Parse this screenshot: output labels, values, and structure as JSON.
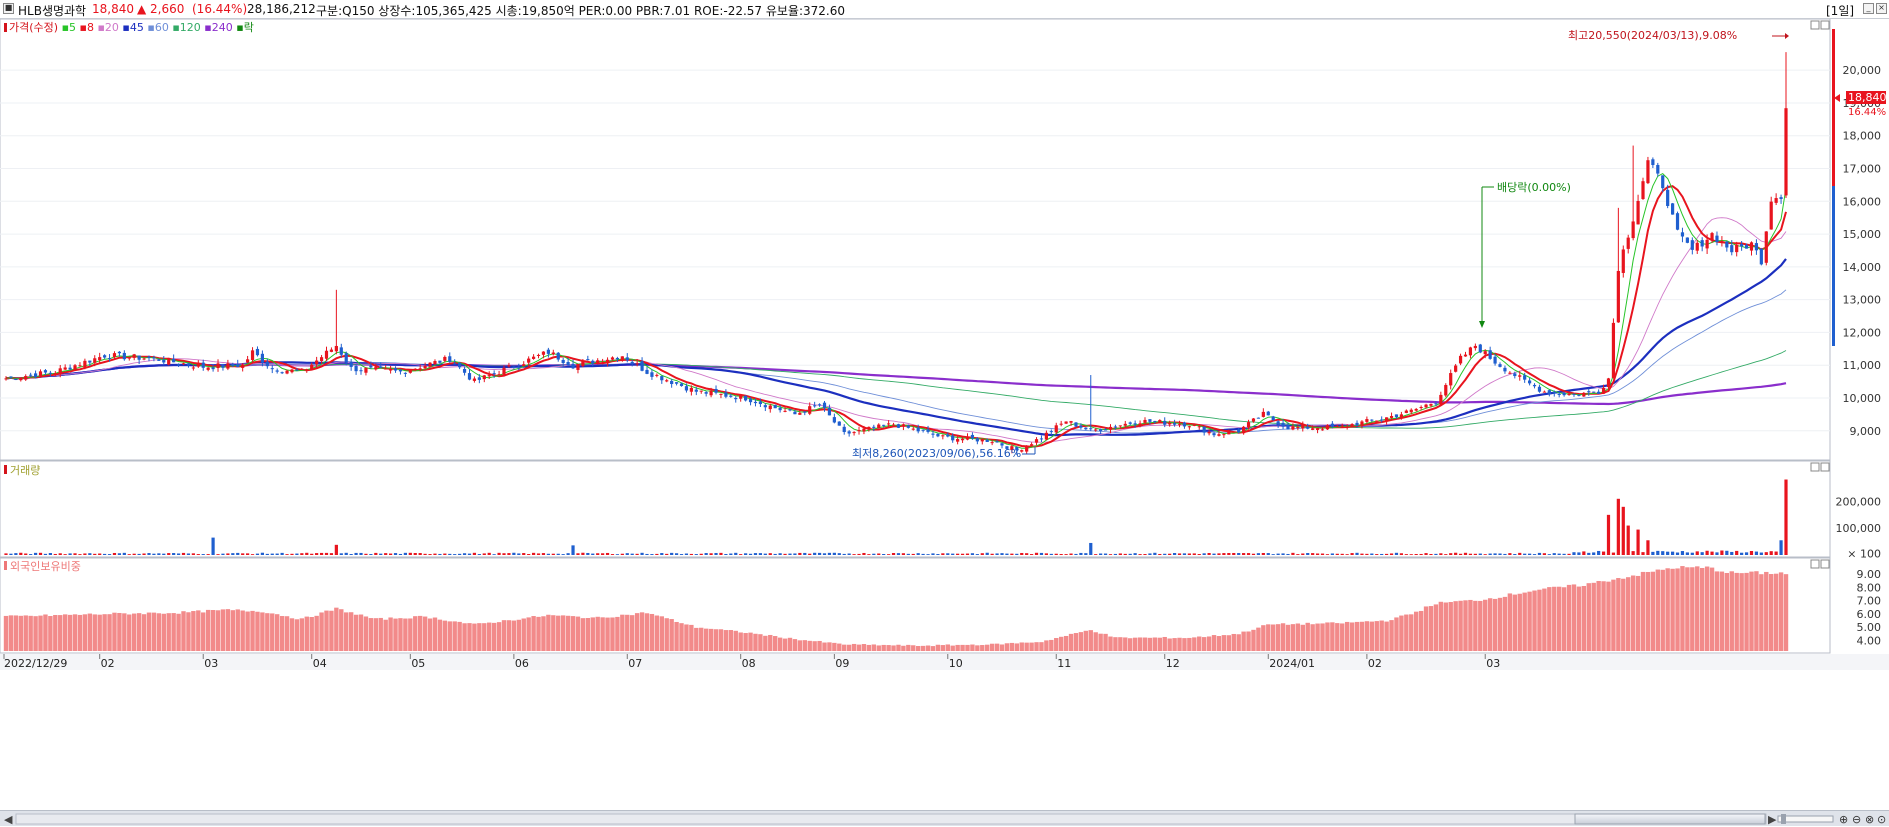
{
  "header": {
    "stock_name": "HLB생명과학",
    "price": "18,840",
    "change": "▲ 2,660",
    "change_pct": "(16.44%)",
    "volume": "28,186,212",
    "info": "구분:Q150 상장수:105,365,425 시총:19,850억 PER:0.00 PBR:7.01 ROE:-22.57 유보율:372.60",
    "period": "[1일]",
    "colors": {
      "up": "#e8141e",
      "down": "#1f5fcf"
    }
  },
  "price_panel": {
    "legend": [
      {
        "text": "가격(수정)",
        "color": "#d4131b"
      },
      {
        "text": "5",
        "color": "#27c427"
      },
      {
        "text": "8",
        "color": "#e8141e"
      },
      {
        "text": "20",
        "color": "#d079c9"
      },
      {
        "text": "45",
        "color": "#1c2fbf"
      },
      {
        "text": "60",
        "color": "#6f8fd8"
      },
      {
        "text": "120",
        "color": "#33aa66"
      },
      {
        "text": "240",
        "color": "#8a2ecc"
      },
      {
        "text": "락",
        "color": "#118811"
      }
    ],
    "high_label": "최고20,550(2024/03/13),9.08%",
    "low_label": "최저8,260(2023/09/06),56.16%",
    "dividend_label": "배당락(0.00%)",
    "current_tag": "18,840",
    "current_pct": "16.44%"
  },
  "volume_panel": {
    "legend": "거래량"
  },
  "foreign_panel": {
    "legend": "외국인보유비중"
  },
  "chart_data": {
    "type": "candlestick",
    "price_axis": {
      "ylim": [
        8200,
        21500
      ],
      "ticks": [
        "9,000",
        "10,000",
        "11,000",
        "12,000",
        "13,000",
        "14,000",
        "15,000",
        "16,000",
        "17,000",
        "18,000",
        "19,000",
        "20,000"
      ]
    },
    "volume_axis": {
      "ylim": [
        0,
        340000
      ],
      "ticks": [
        "200,000",
        "100,000",
        "× 100"
      ]
    },
    "foreign_axis": {
      "ylim": [
        3.2,
        10.0
      ],
      "ticks": [
        "9.00",
        "8.00",
        "7.00",
        "6.00",
        "5.00",
        "4.00"
      ]
    },
    "x_labels": [
      "2022/12/29",
      "02",
      "03",
      "04",
      "05",
      "06",
      "07",
      "08",
      "09",
      "10",
      "11",
      "12",
      "2024/01",
      "02",
      "03"
    ],
    "close_anchors": [
      [
        0,
        10600
      ],
      [
        10,
        10800
      ],
      [
        20,
        11300
      ],
      [
        30,
        11200
      ],
      [
        40,
        10950
      ],
      [
        48,
        11000
      ],
      [
        50,
        11400
      ],
      [
        54,
        10900
      ],
      [
        60,
        10800
      ],
      [
        67,
        11600
      ],
      [
        70,
        10900
      ],
      [
        80,
        10800
      ],
      [
        90,
        11200
      ],
      [
        95,
        10500
      ],
      [
        100,
        10800
      ],
      [
        110,
        11400
      ],
      [
        115,
        11000
      ],
      [
        120,
        11150
      ],
      [
        125,
        11300
      ],
      [
        130,
        10800
      ],
      [
        140,
        10200
      ],
      [
        150,
        10000
      ],
      [
        160,
        9500
      ],
      [
        165,
        9800
      ],
      [
        170,
        8900
      ],
      [
        180,
        9200
      ],
      [
        190,
        8800
      ],
      [
        200,
        8700
      ],
      [
        205,
        8400
      ],
      [
        210,
        8800
      ],
      [
        215,
        9300
      ],
      [
        220,
        9000
      ],
      [
        230,
        9300
      ],
      [
        240,
        9200
      ],
      [
        245,
        8900
      ],
      [
        250,
        9000
      ],
      [
        255,
        9500
      ],
      [
        260,
        9100
      ],
      [
        270,
        9100
      ],
      [
        280,
        9400
      ],
      [
        285,
        9600
      ],
      [
        290,
        9900
      ],
      [
        295,
        11200
      ],
      [
        298,
        11600
      ],
      [
        302,
        11100
      ],
      [
        308,
        10500
      ],
      [
        312,
        10200
      ],
      [
        318,
        10100
      ],
      [
        323,
        10200
      ],
      [
        325,
        10600
      ],
      [
        327,
        14000
      ],
      [
        330,
        15500
      ],
      [
        333,
        17200
      ],
      [
        336,
        16500
      ],
      [
        339,
        15000
      ],
      [
        342,
        14500
      ],
      [
        346,
        15000
      ],
      [
        350,
        14500
      ],
      [
        354,
        14700
      ],
      [
        356,
        14200
      ],
      [
        358,
        16100
      ],
      [
        360,
        16200
      ],
      [
        361,
        18840
      ]
    ],
    "ohlc_samples": [
      {
        "date": "2024/03/13",
        "open": 16180,
        "high": 20550,
        "low": 16100,
        "close": 18840,
        "volume": 28186212
      },
      {
        "date": "2023/09/06",
        "low": 8260
      }
    ],
    "volume_spikes": [
      [
        42,
        65000
      ],
      [
        67,
        38000
      ],
      [
        115,
        36000
      ],
      [
        220,
        45000
      ],
      [
        325,
        150000
      ],
      [
        327,
        210000
      ],
      [
        328,
        180000
      ],
      [
        329,
        110000
      ],
      [
        331,
        95000
      ],
      [
        333,
        55000
      ],
      [
        360,
        55000
      ],
      [
        361,
        282000
      ]
    ],
    "foreign_anchors": [
      [
        0,
        5.8
      ],
      [
        20,
        6.0
      ],
      [
        35,
        6.1
      ],
      [
        45,
        6.3
      ],
      [
        52,
        6.2
      ],
      [
        60,
        5.6
      ],
      [
        67,
        6.4
      ],
      [
        75,
        5.6
      ],
      [
        85,
        5.8
      ],
      [
        95,
        5.2
      ],
      [
        110,
        5.9
      ],
      [
        120,
        5.7
      ],
      [
        130,
        6.1
      ],
      [
        140,
        5.0
      ],
      [
        150,
        4.6
      ],
      [
        160,
        4.1
      ],
      [
        170,
        3.7
      ],
      [
        185,
        3.6
      ],
      [
        200,
        3.7
      ],
      [
        210,
        3.9
      ],
      [
        220,
        4.8
      ],
      [
        225,
        4.2
      ],
      [
        240,
        4.2
      ],
      [
        250,
        4.5
      ],
      [
        256,
        5.2
      ],
      [
        270,
        5.3
      ],
      [
        280,
        5.5
      ],
      [
        285,
        6.0
      ],
      [
        290,
        6.8
      ],
      [
        300,
        7.1
      ],
      [
        310,
        7.8
      ],
      [
        320,
        8.2
      ],
      [
        330,
        8.9
      ],
      [
        338,
        9.5
      ],
      [
        345,
        9.5
      ],
      [
        350,
        9.1
      ],
      [
        360,
        9.1
      ],
      [
        361,
        9.0
      ]
    ]
  }
}
